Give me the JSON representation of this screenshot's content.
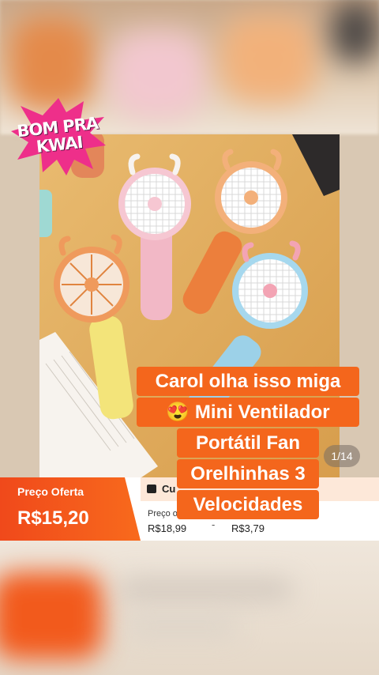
{
  "badge": {
    "line1": "BOM PRA",
    "line2": "KWAI"
  },
  "image_counter": "1/14",
  "price": {
    "offer_label": "Preço Oferta",
    "offer_value": "R$15,20"
  },
  "coupon": {
    "text": "Cu"
  },
  "original": {
    "label": "Preço o",
    "value": "R$18,99",
    "dash": "-",
    "discount": "R$3,79"
  },
  "caption": {
    "line1": "Carol olha isso miga",
    "line2": "😍 Mini Ventilador",
    "line3": "Portátil Fan",
    "line4": "Orelhinhas 3",
    "line5": "Velocidades"
  },
  "colors": {
    "accent": "#f4661c",
    "offer_gradient_start": "#f0491b",
    "badge": "#ee2f8a"
  },
  "product_colors": [
    "#f0b9c8",
    "#f4a86a",
    "#f3a06a",
    "#9cd1e8",
    "#f1e37e"
  ]
}
